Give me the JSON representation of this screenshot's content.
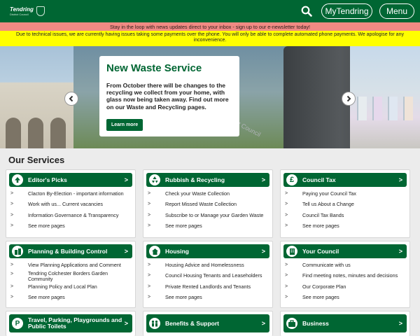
{
  "header": {
    "logo_name": "Tendring",
    "logo_sub": "District Council",
    "my_label": "MyTendring",
    "menu_label": "Menu",
    "brand_color": "#006633",
    "icons": {
      "search": "search-icon"
    }
  },
  "banners": {
    "newsletter": "Stay in the loop with news updates direct to your inbox - sign up to our e-newsletter today!",
    "alert": "Due to technical issues, we are currently having issues taking some payments over the phone. You will only be able to complete automated phone payments. We apologise for any inconvenience."
  },
  "hero": {
    "title": "New Waste Service",
    "description": "From October there will be changes to the recycling we collect from your home, with glass now being taken away. Find out more on our Waste and Recycling pages.",
    "button": "Learn more",
    "bin_text": "Tendring District Council"
  },
  "services": {
    "heading": "Our Services",
    "cards": [
      {
        "title": "Editor's Picks",
        "icon": "arrow-up-icon",
        "links": [
          "Clacton By-Election - important information",
          "Work with us... Current vacancies",
          "Information Governance & Transparency",
          "See more pages"
        ]
      },
      {
        "title": "Rubbish & Recycling",
        "icon": "recycle-icon",
        "links": [
          "Check your Waste Collection",
          "Report Missed Waste Collection",
          "Subscribe to or Manage your Garden Waste",
          "See more pages"
        ]
      },
      {
        "title": "Council Tax",
        "icon": "pound-icon",
        "links": [
          "Paying your Council Tax",
          "Tell us About a Change",
          "Council Tax Bands",
          "See more pages"
        ]
      },
      {
        "title": "Planning & Building Control",
        "icon": "buildings-icon",
        "links": [
          "View Planning Applications and Comment",
          "Tendring Colchester Borders Garden Community",
          "Planning Policy and Local Plan",
          "See more pages"
        ]
      },
      {
        "title": "Housing",
        "icon": "house-icon",
        "links": [
          "Housing Advice and Homelessness",
          "Council Housing Tenants and Leaseholders",
          "Private Rented Landlords and Tenants",
          "See more pages"
        ]
      },
      {
        "title": "Your Council",
        "icon": "building-icon",
        "links": [
          "Communicate with us",
          "Find meeting notes, minutes and decisions",
          "Our Corporate Plan",
          "See more pages"
        ]
      },
      {
        "title": "Travel, Parking, Playgrounds and Public Toilets",
        "icon": "parking-icon",
        "links": []
      },
      {
        "title": "Benefits & Support",
        "icon": "people-icon",
        "links": []
      },
      {
        "title": "Business",
        "icon": "briefcase-icon",
        "links": []
      }
    ]
  }
}
